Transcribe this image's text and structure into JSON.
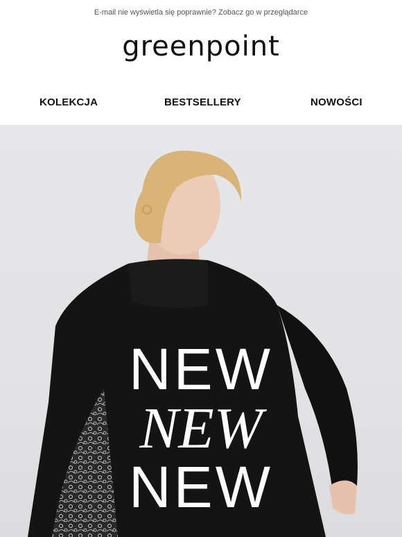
{
  "preheader": {
    "text": "E-mail nie wyświetla się poprawnie? Zobacz go w przeglądarce"
  },
  "brand": {
    "logo_text": "greenpoint"
  },
  "nav": {
    "items": [
      {
        "label": "KOLEKCJA"
      },
      {
        "label": "BESTSELLERY"
      },
      {
        "label": "NOWOŚCI"
      }
    ]
  },
  "hero": {
    "line1": "NEW",
    "line2": "NEW",
    "line3": "NEW",
    "colors": {
      "background": "#e5e5e7",
      "text": "#ffffff",
      "outfit": "#141414",
      "hair": "#d9b77c",
      "skin": "#e9c8b4"
    }
  }
}
